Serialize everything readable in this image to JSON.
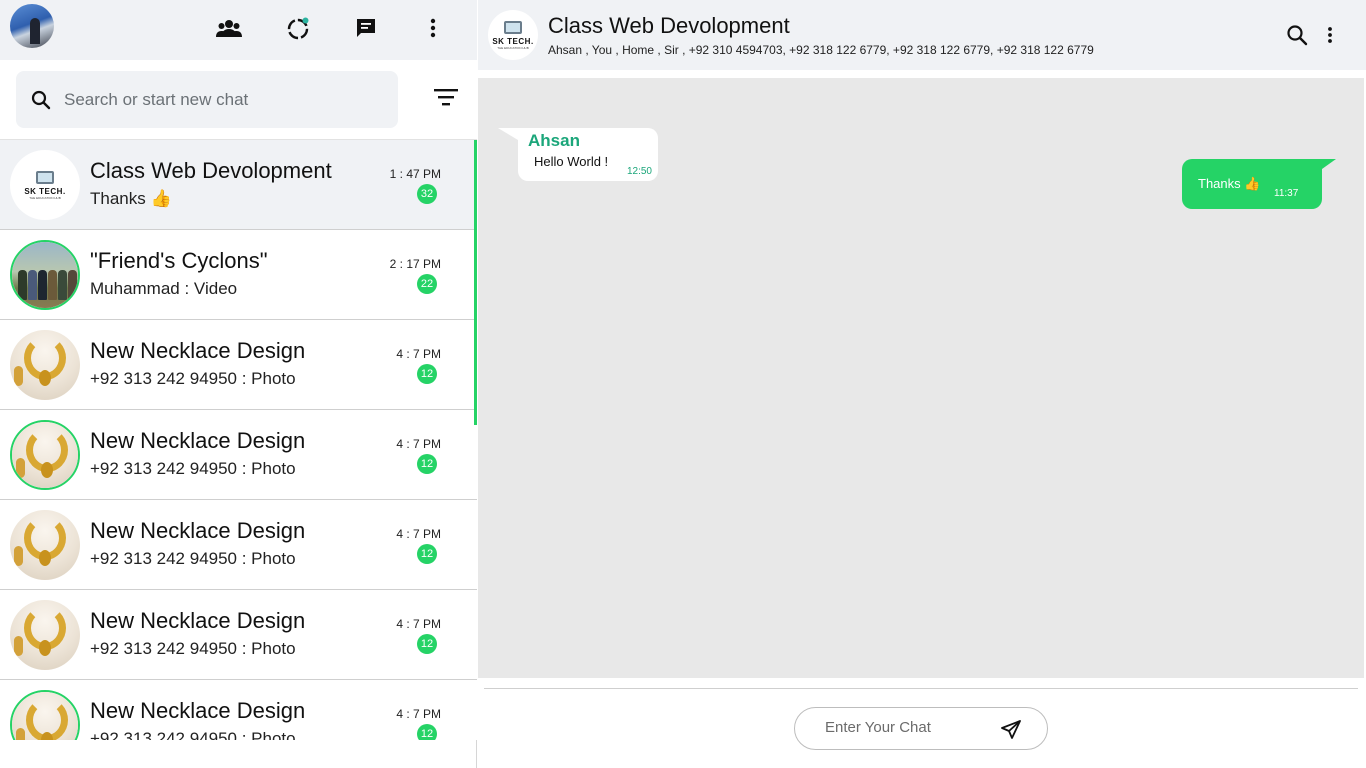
{
  "left_header": {
    "icons": [
      "community-icon",
      "status-icon",
      "new-chat-icon",
      "menu-dots-icon"
    ]
  },
  "search": {
    "placeholder": "Search or start new chat"
  },
  "chats": [
    {
      "name": "Class Web Devolopment",
      "last": "Thanks 👍",
      "time": "1 : 47 PM",
      "unread": "32",
      "avatar": "sk-tech-logo",
      "ring": false,
      "active": true
    },
    {
      "name": "\"Friend's Cyclons\"",
      "last": "Muhammad : Video",
      "time": "2 : 17 PM",
      "unread": "22",
      "avatar": "group-photo",
      "ring": true,
      "active": false
    },
    {
      "name": "New Necklace Design",
      "last": "+92 313 242 94950 : Photo",
      "time": "4 : 7 PM",
      "unread": "12",
      "avatar": "necklace-photo",
      "ring": false,
      "active": false
    },
    {
      "name": "New Necklace Design",
      "last": "+92 313 242 94950 : Photo",
      "time": "4 : 7 PM",
      "unread": "12",
      "avatar": "necklace-photo",
      "ring": true,
      "active": false
    },
    {
      "name": "New Necklace Design",
      "last": "+92 313 242 94950 : Photo",
      "time": "4 : 7 PM",
      "unread": "12",
      "avatar": "necklace-photo",
      "ring": false,
      "active": false
    },
    {
      "name": "New Necklace Design",
      "last": "+92 313 242 94950 : Photo",
      "time": "4 : 7 PM",
      "unread": "12",
      "avatar": "necklace-photo",
      "ring": false,
      "active": false
    },
    {
      "name": "New Necklace Design",
      "last": "+92 313 242 94950 : Photo",
      "time": "4 : 7 PM",
      "unread": "12",
      "avatar": "necklace-photo",
      "ring": true,
      "active": false
    }
  ],
  "conversation": {
    "title": "Class Web Devolopment",
    "members": "Ahsan , You , Home , Sir , +92 310 4594703, +92 318 122 6779, +92 318 122 6779, +92 318 122 6779",
    "logo": {
      "line1": "SK TECH.",
      "line2": "THE EDUCATION HUB"
    },
    "messages": [
      {
        "direction": "in",
        "sender": "Ahsan",
        "text": "Hello World !",
        "time": "12:50"
      },
      {
        "direction": "out",
        "text": "Thanks 👍",
        "time": "11:37"
      }
    ],
    "composer": {
      "placeholder": "Enter Your Chat"
    }
  },
  "colors": {
    "accent": "#25d366",
    "sender_name": "#1ba67a",
    "panel_bg": "#f0f2f5",
    "chat_bg": "#e8e8e8"
  }
}
